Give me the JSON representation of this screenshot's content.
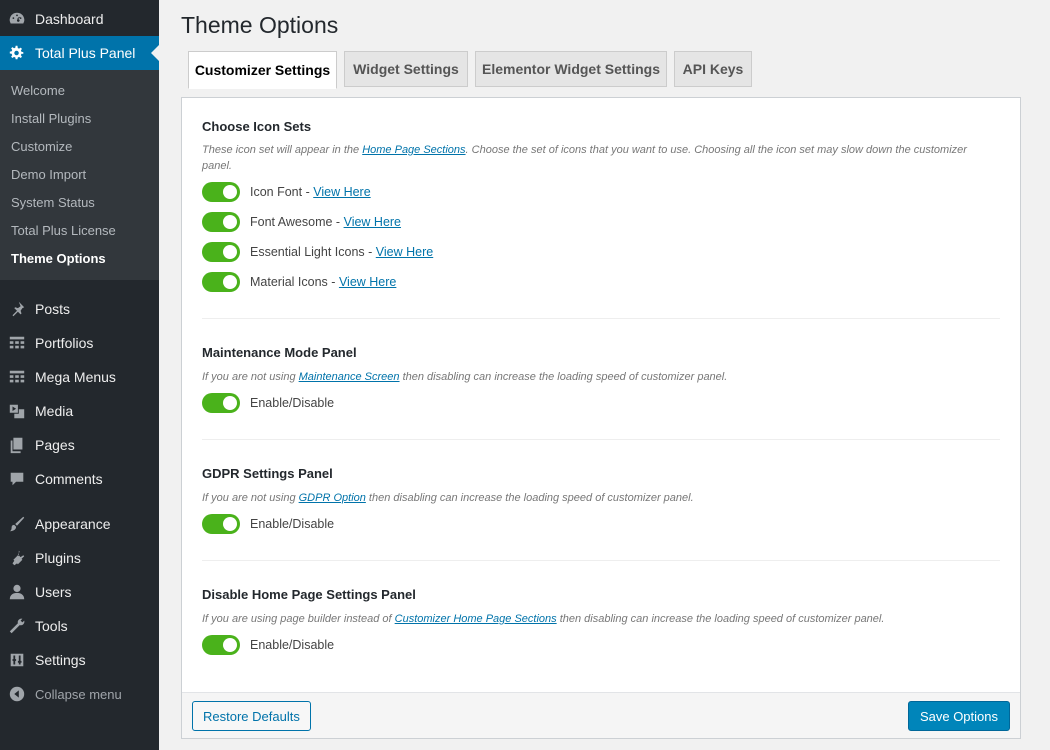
{
  "sidebar": {
    "dashboard": "Dashboard",
    "active_panel": "Total Plus Panel",
    "submenu": [
      "Welcome",
      "Install Plugins",
      "Customize",
      "Demo Import",
      "System Status",
      "Total Plus License",
      "Theme Options"
    ],
    "items": [
      "Posts",
      "Portfolios",
      "Mega Menus",
      "Media",
      "Pages",
      "Comments",
      "Appearance",
      "Plugins",
      "Users",
      "Tools",
      "Settings"
    ],
    "collapse": "Collapse menu"
  },
  "page": {
    "title": "Theme Options"
  },
  "tabs": [
    "Customizer Settings",
    "Widget Settings",
    "Elementor Widget Settings",
    "API Keys"
  ],
  "sections": {
    "icon_sets": {
      "title": "Choose Icon Sets",
      "desc_pre": "These icon set will appear in the ",
      "desc_link": "Home Page Sections",
      "desc_post": ". Choose the set of icons that you want to use. Choosing all the icon set may slow down the customizer panel.",
      "options": [
        {
          "label": "Icon Font - ",
          "link": "View Here"
        },
        {
          "label": "Font Awesome - ",
          "link": "View Here"
        },
        {
          "label": "Essential Light Icons - ",
          "link": "View Here"
        },
        {
          "label": "Material Icons - ",
          "link": "View Here"
        }
      ]
    },
    "maintenance": {
      "title": "Maintenance Mode Panel",
      "desc_pre": "If you are not using ",
      "desc_link": "Maintenance Screen",
      "desc_post": " then disabling can increase the loading speed of customizer panel.",
      "toggle_label": "Enable/Disable"
    },
    "gdpr": {
      "title": "GDPR Settings Panel",
      "desc_pre": "If you are not using ",
      "desc_link": "GDPR Option",
      "desc_post": " then disabling can increase the loading speed of customizer panel.",
      "toggle_label": "Enable/Disable"
    },
    "home": {
      "title": "Disable Home Page Settings Panel",
      "desc_pre": "If you are using page builder instead of ",
      "desc_link": "Customizer Home Page Sections",
      "desc_post": " then disabling can increase the loading speed of customizer panel.",
      "toggle_label": "Enable/Disable"
    }
  },
  "footer": {
    "restore": "Restore Defaults",
    "save": "Save Options"
  },
  "colors": {
    "sidebar_bg": "#23282d",
    "accent": "#0073aa",
    "toggle_on": "#4ab21b"
  }
}
